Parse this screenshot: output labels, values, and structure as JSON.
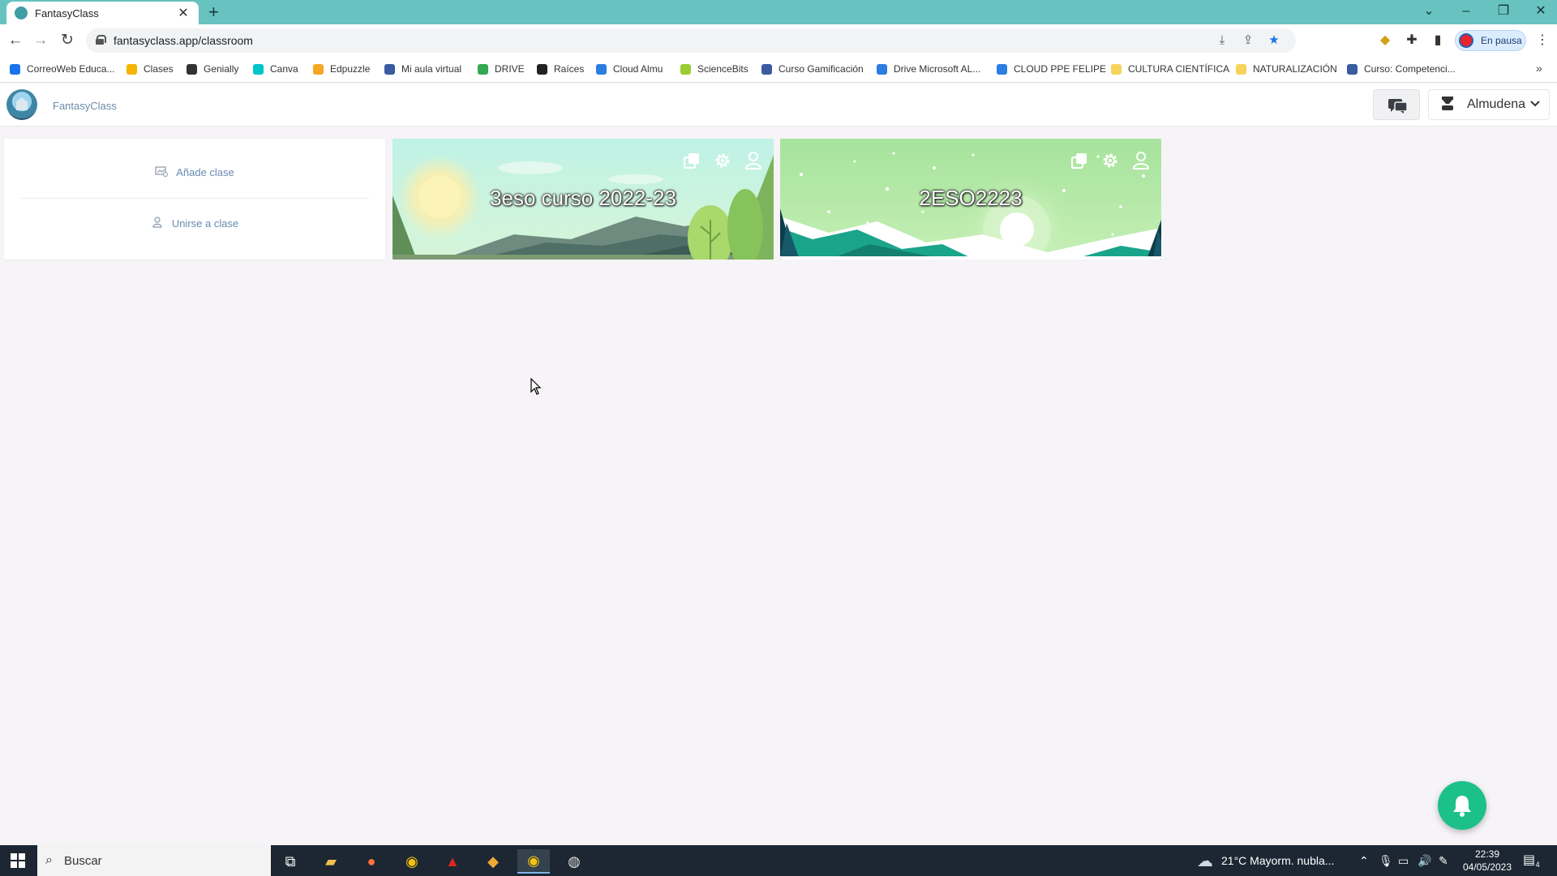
{
  "browser": {
    "tab_title": "FantasyClass",
    "tab_close": "✕",
    "new_tab": "+",
    "url": "fantasyclass.app/classroom",
    "profile_status": "En pausa",
    "bookmarks": [
      {
        "label": "CorreoWeb Educa...",
        "color": "#1a73e8"
      },
      {
        "label": "Clases",
        "color": "#f4b400"
      },
      {
        "label": "Genially",
        "color": "#333333"
      },
      {
        "label": "Canva",
        "color": "#00c4cc"
      },
      {
        "label": "Edpuzzle",
        "color": "#f5a623"
      },
      {
        "label": "Mi aula virtual",
        "color": "#3a5ba0"
      },
      {
        "label": "DRIVE",
        "color": "#34a853"
      },
      {
        "label": "Raíces",
        "color": "#222222"
      },
      {
        "label": "Cloud Almu",
        "color": "#2a7de1"
      },
      {
        "label": "ScienceBits",
        "color": "#9acd32"
      },
      {
        "label": "Curso Gamificación",
        "color": "#3a5ba0"
      },
      {
        "label": "Drive Microsoft AL...",
        "color": "#2a7de1"
      },
      {
        "label": "CLOUD PPE FELIPE",
        "color": "#2a7de1"
      },
      {
        "label": "CULTURA CIENTÍFICA",
        "color": "#f6d35b"
      },
      {
        "label": "NATURALIZACIÓN",
        "color": "#f6d35b"
      },
      {
        "label": "Curso: Competenci...",
        "color": "#3a5ba0"
      }
    ],
    "bookmarks_more": "»"
  },
  "app": {
    "name": "FantasyClass",
    "user_name": "Almudena"
  },
  "sidebar": {
    "add_class": "Añade clase",
    "join_class": "Unirse a clase"
  },
  "classes": [
    {
      "title": "3eso curso 2022-23",
      "theme": "mountain"
    },
    {
      "title": "2ESO2223",
      "theme": "snow"
    }
  ],
  "taskbar": {
    "search_placeholder": "Buscar",
    "weather": "21°C  Mayorm. nubla...",
    "time": "22:39",
    "date": "04/05/2023",
    "notification_count": "4"
  },
  "colors": {
    "tabbar": "#67c2c0",
    "accent_green": "#1cc18a",
    "link_blue": "#6a8bb0"
  }
}
